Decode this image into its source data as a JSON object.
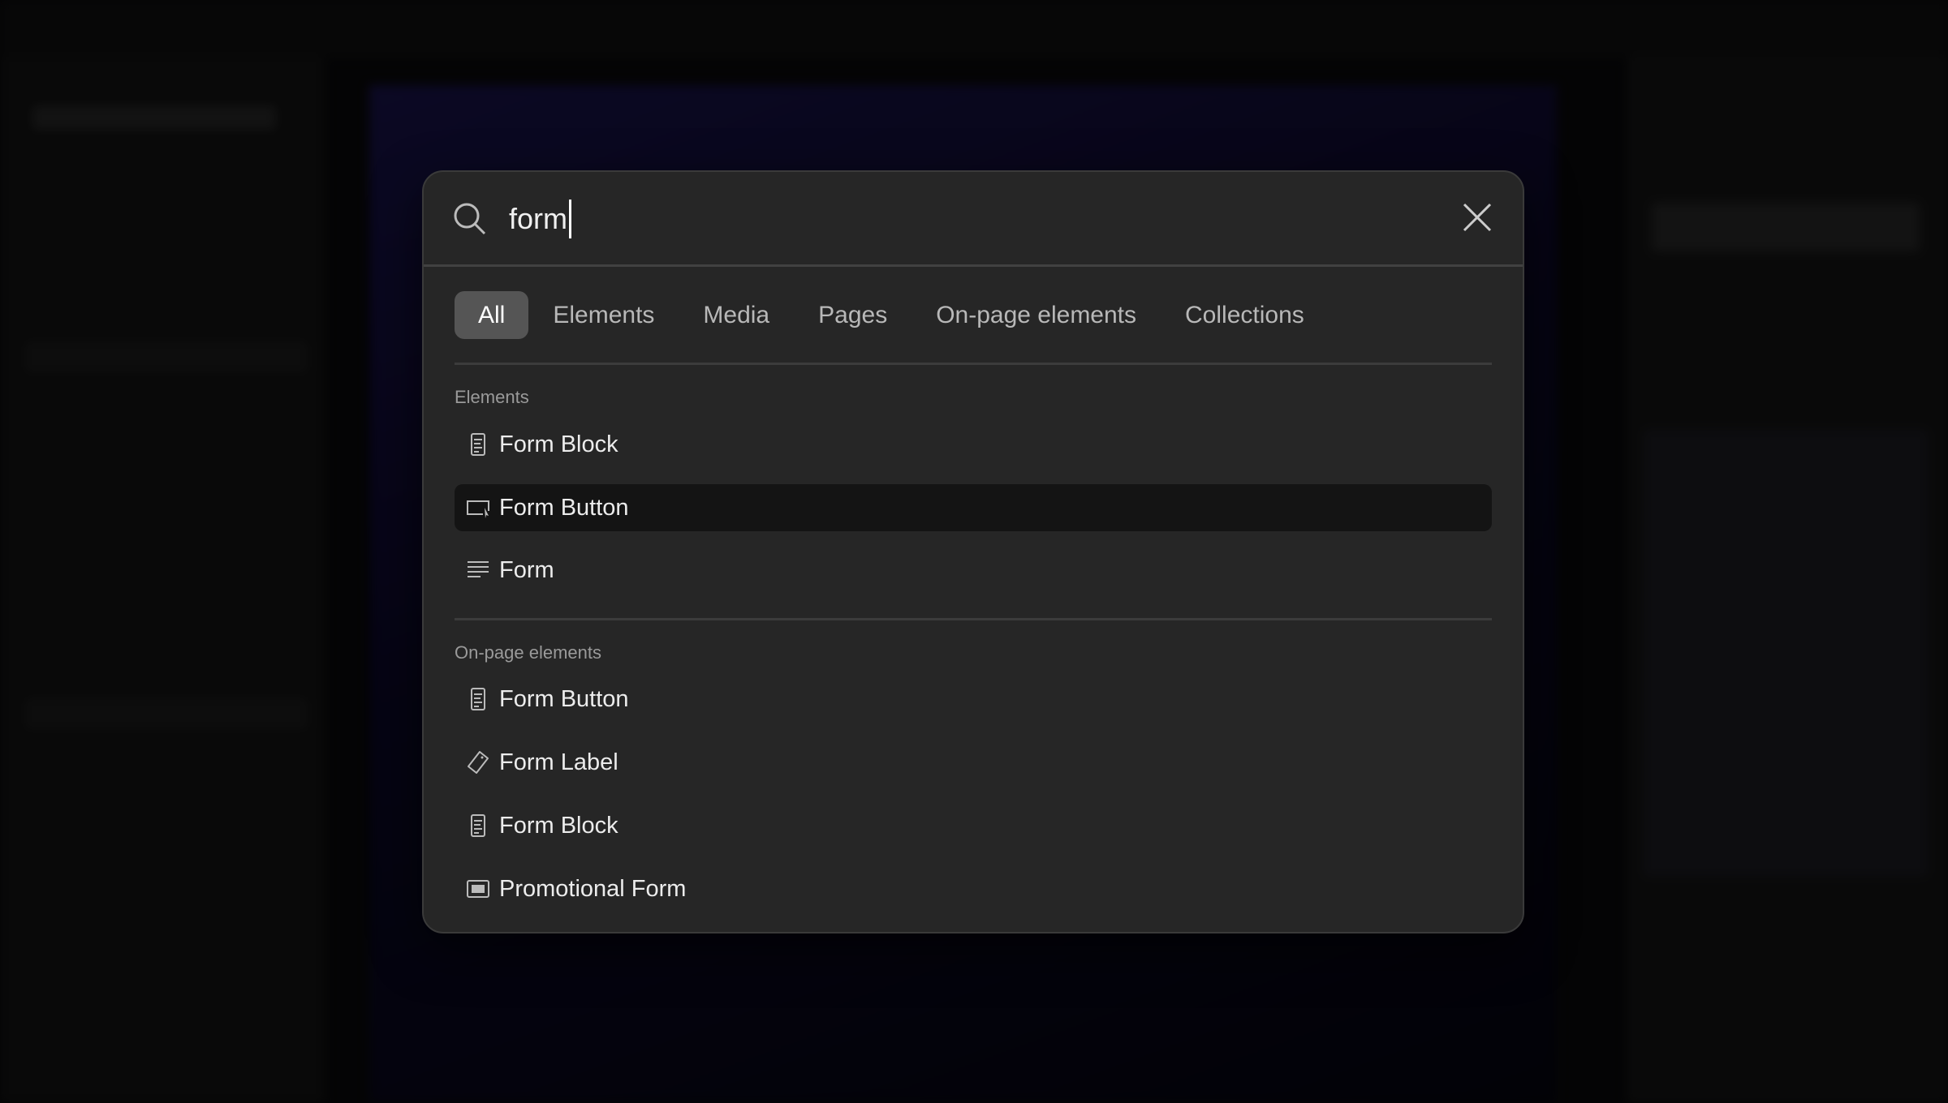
{
  "search": {
    "query": "form"
  },
  "tabs": [
    {
      "label": "All",
      "active": true
    },
    {
      "label": "Elements"
    },
    {
      "label": "Media"
    },
    {
      "label": "Pages"
    },
    {
      "label": "On-page elements"
    },
    {
      "label": "Collections"
    }
  ],
  "sections": [
    {
      "title": "Elements",
      "items": [
        {
          "label": "Form Block",
          "icon": "document-icon"
        },
        {
          "label": "Form Button",
          "icon": "button-cursor-icon",
          "highlighted": true
        },
        {
          "label": "Form",
          "icon": "lines-icon"
        }
      ]
    },
    {
      "title": "On-page elements",
      "items": [
        {
          "label": "Form Button",
          "icon": "document-icon"
        },
        {
          "label": "Form Label",
          "icon": "tag-icon"
        },
        {
          "label": "Form Block",
          "icon": "document-icon"
        },
        {
          "label": "Promotional Form",
          "icon": "filled-box-icon"
        }
      ]
    }
  ],
  "colors": {
    "modal_bg": "#262626",
    "highlight": "#141414",
    "active_tab": "#555555"
  }
}
